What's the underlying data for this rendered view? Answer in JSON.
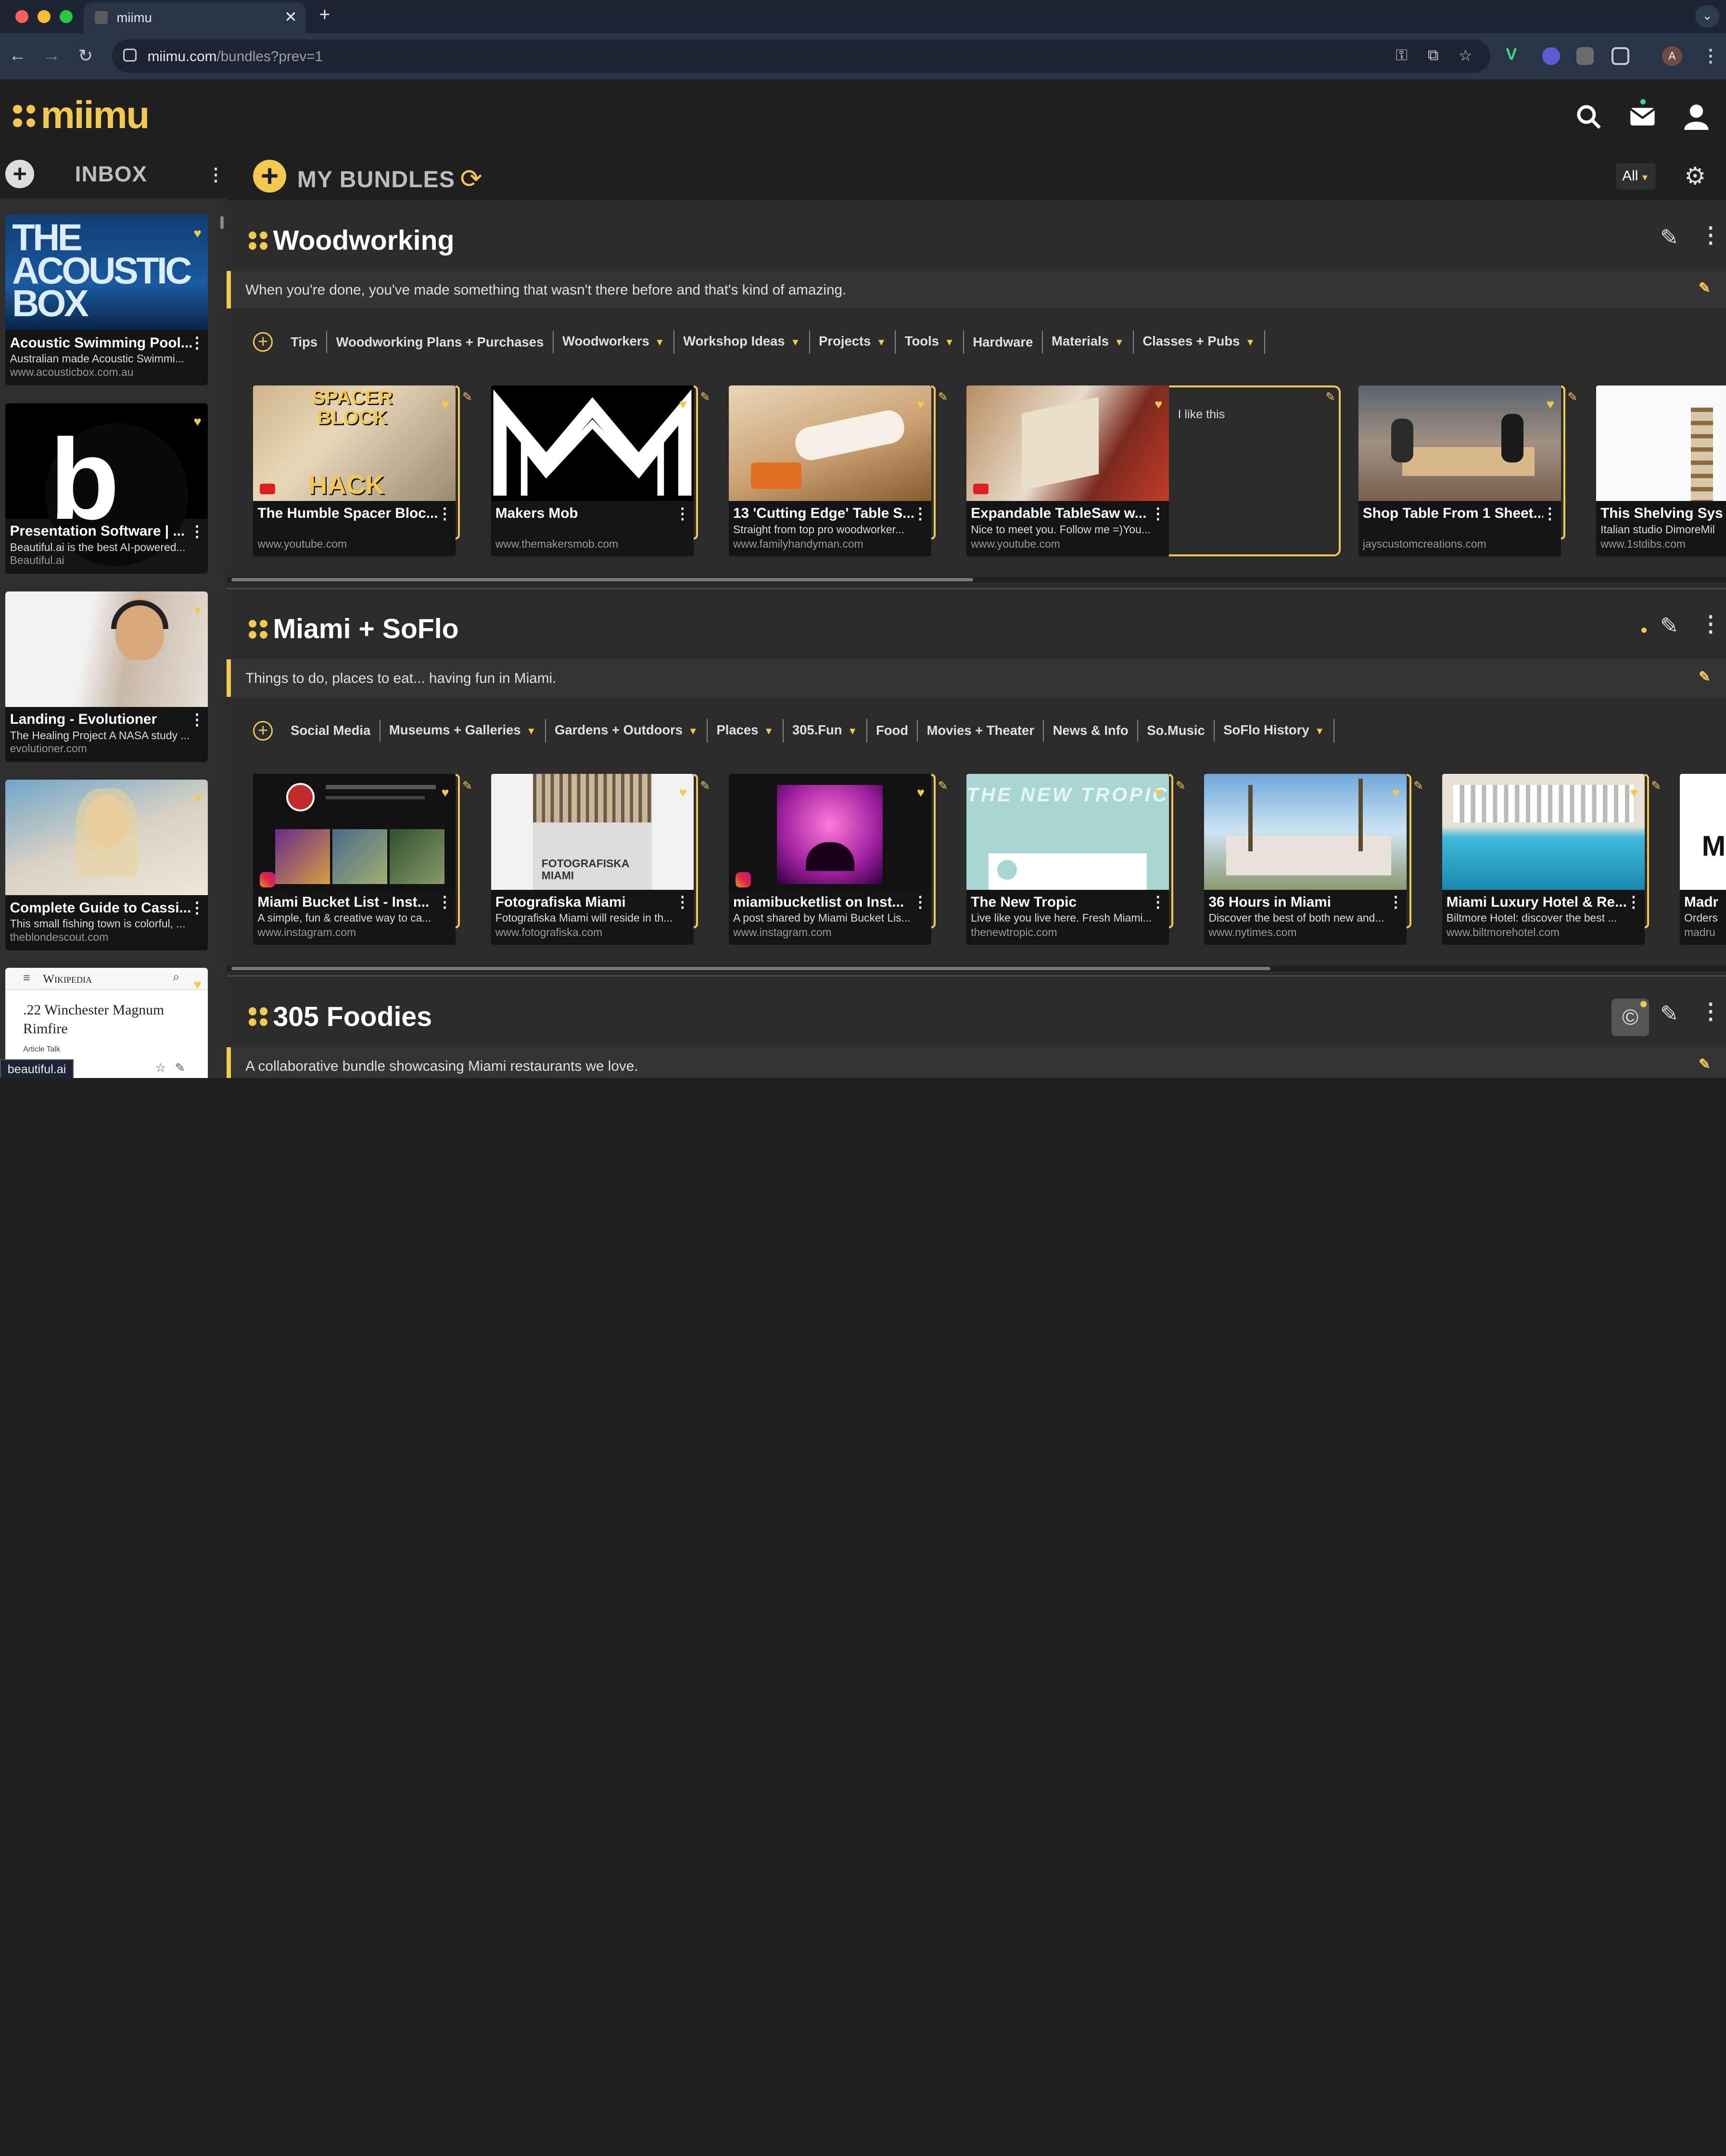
{
  "browser": {
    "tab_title": "miimu",
    "url_host": "miimu.com",
    "url_path": "/bundles?prev=1",
    "profile_initial": "A",
    "status_url": "beautiful.ai"
  },
  "app": {
    "logo": "miimu"
  },
  "sidebar": {
    "title": "INBOX",
    "cards": [
      {
        "title": "Acoustic Swimming Pool...",
        "desc": "Australian made Acoustic Swimmi...",
        "url": "www.acousticbox.com.au",
        "img_text": "THE ACOUSTIC BOX"
      },
      {
        "title": "Presentation Software | ...",
        "desc": "Beautiful.ai is the best AI-powered...",
        "url": "Beautiful.ai",
        "img_text": "b"
      },
      {
        "title": "Landing - Evolutioner",
        "desc": "The Healing Project A NASA study ...",
        "url": "evolutioner.com"
      },
      {
        "title": "Complete Guide to Cassi...",
        "desc": "This small fishing town is colorful, ...",
        "url": "theblondescout.com"
      },
      {
        "title": ".22 Winchester Magnum Rimfire",
        "brand": "Wikipedia",
        "tabs": "Article   Talk"
      }
    ]
  },
  "main": {
    "title": "MY BUNDLES",
    "filter": "All"
  },
  "bundles": [
    {
      "title": "Woodworking",
      "desc": "When you're done, you've made something that wasn't there before and that's kind of amazing.",
      "categories": [
        {
          "label": "Tips",
          "drop": false
        },
        {
          "label": "Woodworking Plans + Purchases",
          "drop": false
        },
        {
          "label": "Woodworkers",
          "drop": true
        },
        {
          "label": "Workshop Ideas",
          "drop": true
        },
        {
          "label": "Projects",
          "drop": true
        },
        {
          "label": "Tools",
          "drop": true
        },
        {
          "label": "Hardware",
          "drop": false
        },
        {
          "label": "Materials",
          "drop": true
        },
        {
          "label": "Classes + Pubs",
          "drop": true
        }
      ],
      "cards": [
        {
          "title": "The Humble Spacer Bloc...",
          "desc": "",
          "url": "www.youtube.com",
          "img_text_1": "SPACER BLOCK",
          "img_text_2": "HACK"
        },
        {
          "title": "Makers Mob",
          "desc": "",
          "url": "www.themakersmob.com"
        },
        {
          "title": "13 'Cutting Edge' Table S...",
          "desc": "Straight from top pro woodworker...",
          "url": "www.familyhandyman.com"
        },
        {
          "title": "Expandable TableSaw w...",
          "desc": "Nice to meet you. Follow me =)You...",
          "url": "www.youtube.com",
          "note": "I like this"
        },
        {
          "title": "Shop Table From 1 Sheet...",
          "desc": "",
          "url": "jayscustomcreations.com"
        },
        {
          "title": "This Shelving Sys",
          "desc": "Italian studio DimoreMil",
          "url": "www.1stdibs.com"
        }
      ]
    },
    {
      "title": "Miami + SoFlo",
      "desc": "Things to do, places to eat... having fun in Miami.",
      "categories": [
        {
          "label": "Social Media",
          "drop": false
        },
        {
          "label": "Museums + Galleries",
          "drop": true
        },
        {
          "label": "Gardens + Outdoors",
          "drop": true
        },
        {
          "label": "Places",
          "drop": true
        },
        {
          "label": "305.Fun",
          "drop": true
        },
        {
          "label": "Food",
          "drop": false
        },
        {
          "label": "Movies + Theater",
          "drop": false
        },
        {
          "label": "News & Info",
          "drop": false
        },
        {
          "label": "So.Music",
          "drop": false
        },
        {
          "label": "SoFlo History",
          "drop": true
        }
      ],
      "cards": [
        {
          "title": "Miami Bucket List - Inst...",
          "desc": "A simple, fun & creative way to ca...",
          "url": "www.instagram.com"
        },
        {
          "title": "Fotografiska Miami",
          "desc": "Fotografiska Miami will reside in th...",
          "url": "www.fotografiska.com",
          "img_text": "FOTOGRAFISKA MIAMI"
        },
        {
          "title": "miamibucketlist on Inst...",
          "desc": "A post shared by Miami Bucket Lis...",
          "url": "www.instagram.com"
        },
        {
          "title": "The New Tropic",
          "desc": "Live like you live here. Fresh Miami...",
          "url": "thenewtropic.com",
          "img_text": "THE NEW TROPIC"
        },
        {
          "title": "36 Hours in Miami",
          "desc": "Discover the best of both new and...",
          "url": "www.nytimes.com"
        },
        {
          "title": "Miami Luxury Hotel & Re...",
          "desc": "Biltmore Hotel: discover the best ...",
          "url": "www.biltmorehotel.com"
        },
        {
          "title": "Madr",
          "desc": "Orders",
          "url": "madru"
        }
      ]
    },
    {
      "title": "305 Foodies",
      "desc": "A collaborative bundle showcasing Miami restaurants we love."
    }
  ],
  "colors": {
    "accent": "#f2c94c",
    "bg": "#2b2b2b",
    "header": "#1f1f1f"
  }
}
